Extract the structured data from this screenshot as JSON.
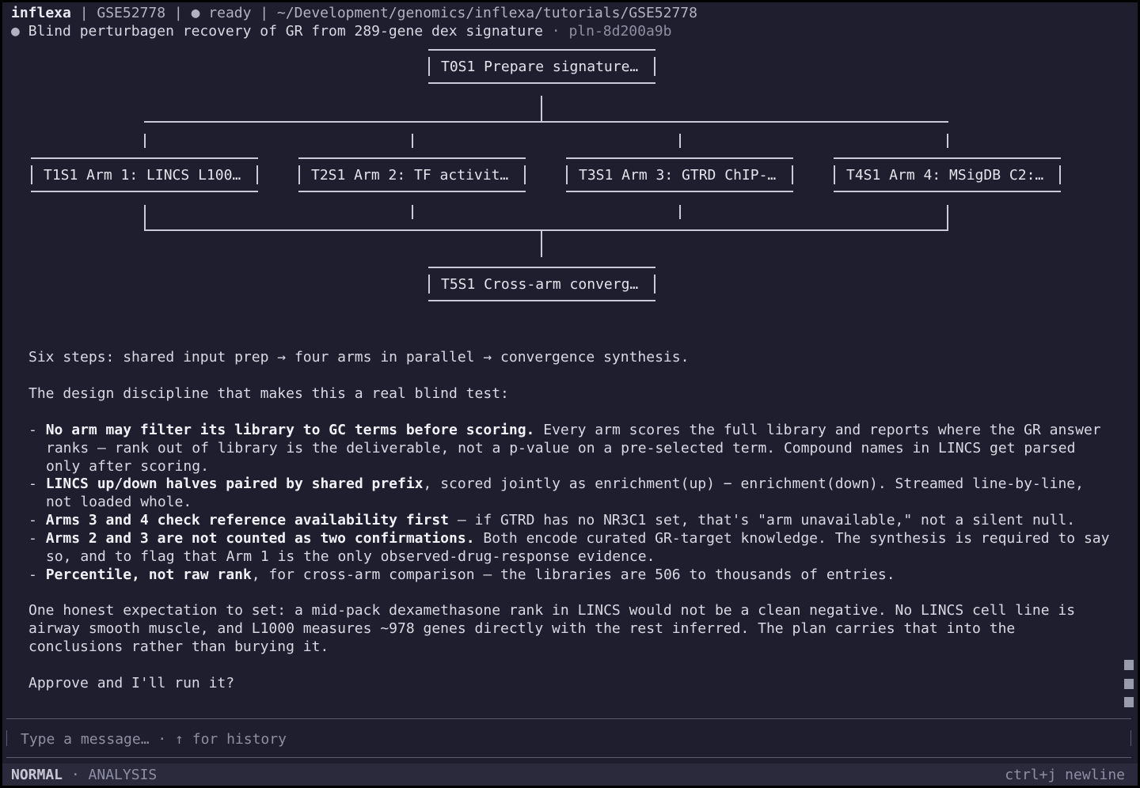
{
  "header": {
    "app": "inflexa",
    "dataset": "GSE52778",
    "state": "● ready",
    "path": "~/Development/genomics/inflexa/tutorials/GSE52778",
    "sep": " | ",
    "plan_bullet": "●",
    "plan_title": "Blind perturbagen recovery of GR from 289-gene dex signature",
    "plan_sep": "·",
    "plan_id": "pln-8d200a9b"
  },
  "plan": {
    "root": "T0S1 Prepare signature…",
    "arms": [
      "T1S1 Arm 1: LINCS L100…",
      "T2S1 Arm 2: TF activit…",
      "T3S1 Arm 3: GTRD ChIP-…",
      "T4S1 Arm 4: MSigDB C2:…"
    ],
    "sink": "T5S1 Cross-arm converg…"
  },
  "message": {
    "summary": "Six steps: shared input prep → four arms in parallel → convergence synthesis.",
    "intro": "The design discipline that makes this a real blind test:",
    "bullets": [
      {
        "bold": "No arm may filter its library to GC terms before scoring.",
        "text": " Every arm scores the full library and reports where the GR answer",
        "cont": [
          "ranks — rank out of library is the deliverable, not a p-value on a pre-selected term. Compound names in LINCS get parsed",
          "only after scoring."
        ]
      },
      {
        "bold": "LINCS up/down halves paired by shared prefix",
        "text": ", scored jointly as enrichment(up) − enrichment(down). Streamed line-by-line,",
        "cont": [
          "not loaded whole."
        ]
      },
      {
        "bold": "Arms 3 and 4 check reference availability first",
        "text": " — if GTRD has no NR3C1 set, that's \"arm unavailable,\" not a silent null.",
        "cont": []
      },
      {
        "bold": "Arms 2 and 3 are not counted as two confirmations.",
        "text": " Both encode curated GR-target knowledge. The synthesis is required to say",
        "cont": [
          "so, and to flag that Arm 1 is the only observed-drug-response evidence."
        ]
      },
      {
        "bold": "Percentile, not raw rank",
        "text": ", for cross-arm comparison — the libraries are 506 to thousands of entries.",
        "cont": []
      }
    ],
    "expectation": [
      "One honest expectation to set: a mid-pack dexamethasone rank in LINCS would not be a clean negative. No LINCS cell line is",
      "airway smooth muscle, and L1000 measures ~978 genes directly with the rest inferred. The plan carries that into the",
      "conclusions rather than burying it."
    ],
    "question": "Approve and I'll run it?"
  },
  "input": {
    "placeholder": "Type a message… · ↑ for history"
  },
  "statusbar": {
    "mode": "NORMAL",
    "sep": " · ",
    "view": "ANALYSIS",
    "hint": "ctrl+j newline"
  }
}
